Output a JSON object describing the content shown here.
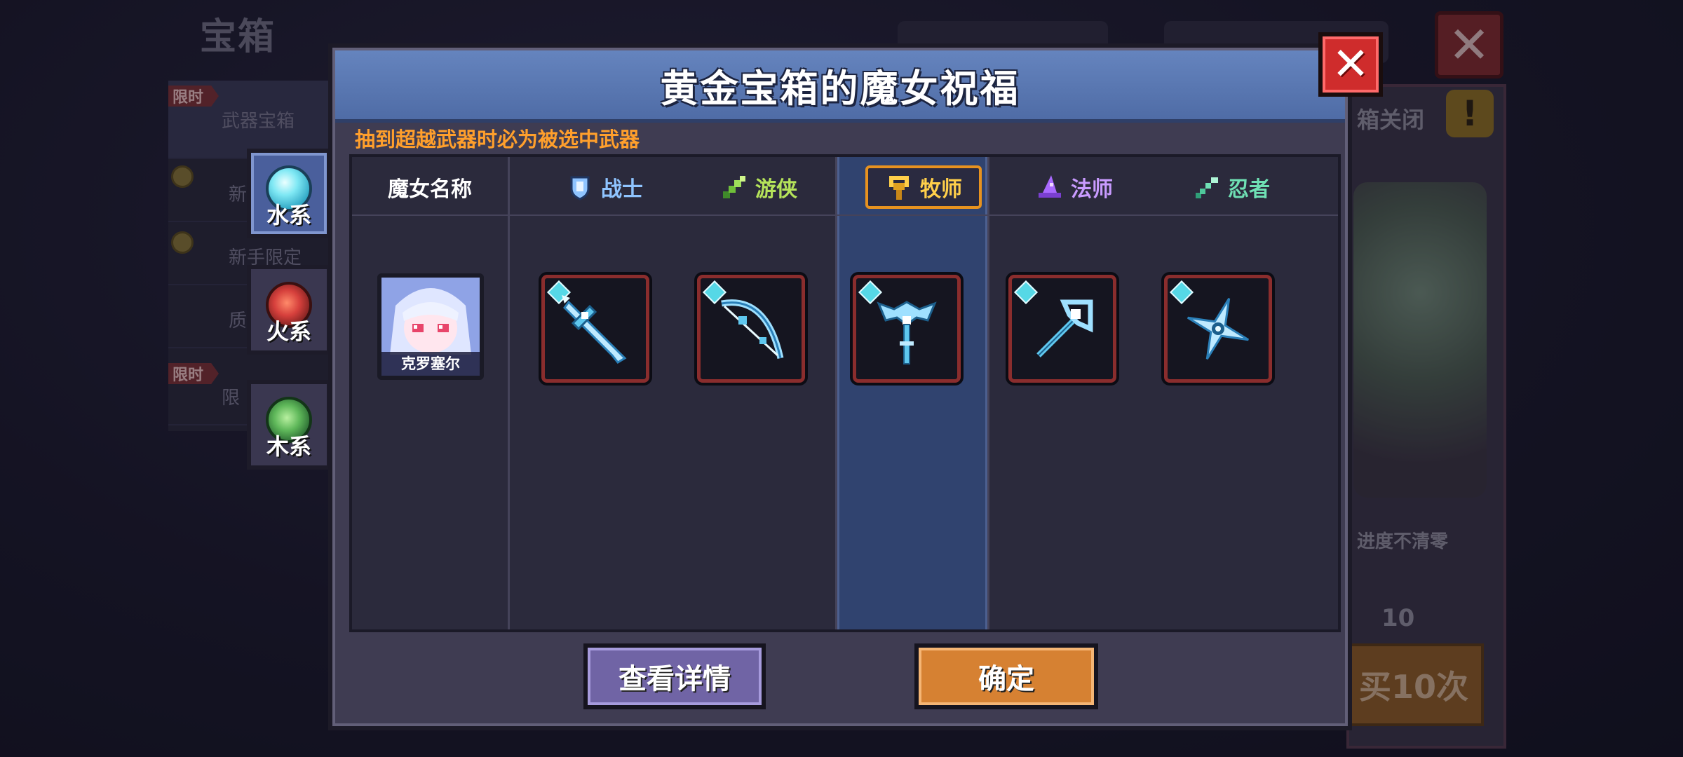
{
  "background": {
    "title": "宝箱",
    "sidebar": {
      "limited_tag_1": "限时",
      "item_1": "武器宝箱",
      "item_2": "新",
      "item_3": "新手限定",
      "item_4": "质",
      "limited_tag_2": "限时",
      "item_5": "限"
    },
    "right_panel": {
      "header_text": "箱关闭",
      "progress_note": "进度不清零",
      "count": "10",
      "buy_label": "买10次"
    }
  },
  "element_tabs": [
    {
      "label": "水系",
      "gem_color": "#7fe8f4",
      "active": true
    },
    {
      "label": "火系",
      "gem_color": "#d6403c",
      "active": false
    },
    {
      "label": "木系",
      "gem_color": "#5fb85a",
      "active": false
    }
  ],
  "dialog": {
    "title": "黄金宝箱的魔女祝福",
    "hint": "抽到超越武器时必为被选中武器",
    "witch_column_header": "魔女名称",
    "witch_name": "克罗塞尔",
    "classes": [
      {
        "label": "战士",
        "color": "#8fc4ff",
        "icon": "warrior-shield-icon",
        "weapon": "ice-sword-icon",
        "selected": false
      },
      {
        "label": "游侠",
        "color": "#b5e35a",
        "icon": "ranger-leaf-icon",
        "weapon": "ice-bow-icon",
        "selected": false
      },
      {
        "label": "牧师",
        "color": "#ffcf4a",
        "icon": "priest-chalice-icon",
        "weapon": "ice-staff-icon",
        "selected": true
      },
      {
        "label": "法师",
        "color": "#c99bff",
        "icon": "mage-hat-icon",
        "weapon": "ice-wand-icon",
        "selected": false
      },
      {
        "label": "忍者",
        "color": "#6fe0b4",
        "icon": "ninja-blade-icon",
        "weapon": "ice-shuriken-icon",
        "selected": false
      }
    ],
    "detail_button": "查看详情",
    "confirm_button": "确定"
  },
  "colors": {
    "accent_blue": "#5876b2",
    "selected_orange": "#e7921f",
    "close_red": "#cf2c2c",
    "hint_orange": "#ff9f2c"
  }
}
